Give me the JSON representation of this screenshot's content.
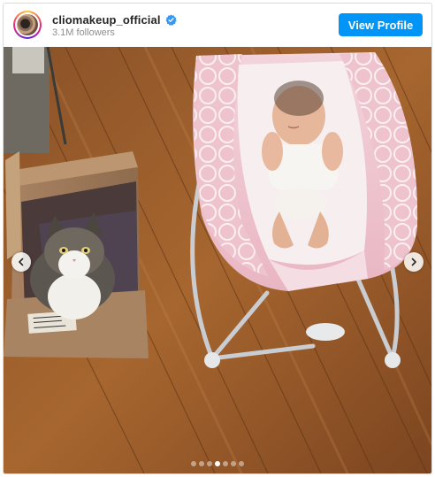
{
  "profile": {
    "username": "cliomakeup_official",
    "followers": "3.1M followers",
    "verified": true,
    "view_profile_label": "View Profile"
  },
  "post": {
    "carousel_total": 7,
    "carousel_active_index": 3,
    "icons": {
      "previous": "chevron-left-icon",
      "next": "chevron-right-icon",
      "verified": "verified-badge-icon"
    }
  },
  "colors": {
    "accent": "#0095f6",
    "verified": "#3897f0",
    "username": "#262626",
    "muted": "#8e8e8e"
  }
}
